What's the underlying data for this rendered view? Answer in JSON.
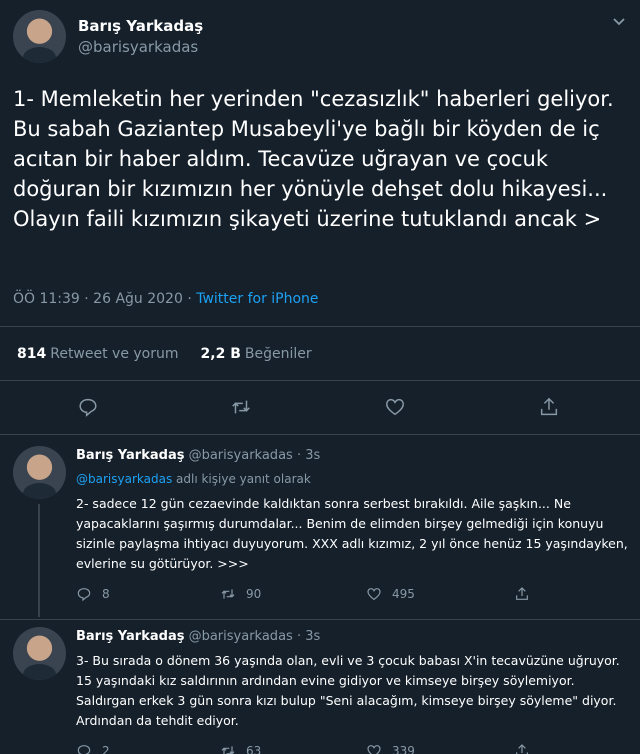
{
  "main_tweet": {
    "author_name": "Barış Yarkadaş",
    "author_handle": "@barisyarkadas",
    "text": "1- Memleketin her yerinden \"cezasızlık\" haberleri geliyor. Bu sabah Gaziantep Musabeyli'ye bağlı bir köyden de iç acıtan bir haber aldım. Tecavüze uğrayan ve çocuk doğuran bir kızımızın her yönüyle dehşet dolu hikayesi... Olayın faili kızımızın şikayeti üzerine tutuklandı ancak >",
    "timestamp": "ÖÖ 11:39 · 26 Ağu 2020 · ",
    "client": "Twitter for iPhone",
    "retweets_count": "814",
    "retweets_label": "Retweet ve yorum",
    "likes_count": "2,2 B",
    "likes_label": "Beğeniler"
  },
  "replies": [
    {
      "author_name": "Barış Yarkadaş",
      "author_handle": "@barisyarkadas",
      "time": "· 3s",
      "reply_to_mention": "@barisyarkadas",
      "reply_to_suffix": " adlı kişiye yanıt olarak",
      "text": "2- sadece 12 gün cezaevinde kaldıktan sonra serbest bırakıldı. Aile şaşkın... Ne yapacaklarını şaşırmış durumdalar... Benim de elimden birşey gelmediği için konuyu sizinle paylaşma ihtiyacı duyuyorum. XXX adlı kızımız, 2 yıl önce henüz 15 yaşındayken, evlerine su götürüyor. >>>",
      "replies_count": "8",
      "retweets_count": "90",
      "likes_count": "495"
    },
    {
      "author_name": "Barış Yarkadaş",
      "author_handle": "@barisyarkadas",
      "time": "· 3s",
      "text": "3- Bu sırada o dönem 36 yaşında olan, evli ve 3 çocuk babası X'in tecavüzüne uğruyor. 15 yaşındaki kız saldırının ardından evine gidiyor ve kimseye birşey söylemiyor. Saldırgan erkek 3 gün sonra kızı bulup \"Seni alacağım, kimseye birşey söyleme\" diyor. Ardından da tehdit ediyor.",
      "replies_count": "2",
      "retweets_count": "63",
      "likes_count": "339"
    }
  ],
  "icons": {
    "reply": "reply-icon",
    "retweet": "retweet-icon",
    "like": "heart-icon",
    "share": "share-icon",
    "more": "chevron-down-icon"
  },
  "colors": {
    "background": "#15202b",
    "accent": "#1da1f2",
    "secondary_text": "#8899a6",
    "divider": "#38444d"
  }
}
